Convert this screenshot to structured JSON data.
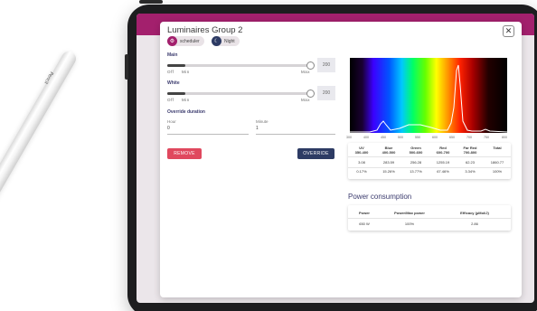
{
  "pencil": {
    "brand": "Pencil"
  },
  "modal": {
    "title": "Luminaires Group 2",
    "close_label": "✕",
    "chips": [
      {
        "label": "scheduler",
        "icon": "scheduler-icon",
        "color": "#a3206d"
      },
      {
        "label": "Night",
        "icon": "moon-icon",
        "color": "#2d3b64"
      }
    ]
  },
  "main": {
    "label": "Main",
    "off": "Off",
    "min": "Min",
    "max": "Max",
    "value": "200",
    "level": 1.0
  },
  "white": {
    "label": "White",
    "off": "Off",
    "min": "Min",
    "max": "Max",
    "value": "200",
    "level": 1.0
  },
  "override": {
    "label": "Override duration",
    "hour_label": "Hour",
    "hour_value": "0",
    "minute_label": "Minute",
    "minute_value": "1",
    "remove_label": "REMOVE",
    "override_label": "OVERRIDE"
  },
  "colors": {
    "accent": "#a3206d",
    "navy": "#2d3b64",
    "remove": "#e0485e"
  },
  "spectrum": {
    "ticks": [
      "300",
      "400",
      "450",
      "500",
      "550",
      "600",
      "650",
      "700",
      "750",
      "800"
    ]
  },
  "bands_table": {
    "headers": [
      [
        "UV",
        "350-400"
      ],
      [
        "Blue",
        "400-500"
      ],
      [
        "Green",
        "500-600"
      ],
      [
        "Red",
        "600-700"
      ],
      [
        "Far Red",
        "700-800"
      ],
      [
        "Total",
        ""
      ]
    ],
    "rows": [
      [
        "3.08",
        "283.59",
        "256.28",
        "1255.19",
        "62.23",
        "1860.77"
      ],
      [
        "0.17%",
        "15.26%",
        "13.77%",
        "67.46%",
        "3.34%",
        "100%"
      ]
    ]
  },
  "power": {
    "title": "Power consumption",
    "headers": [
      "Power",
      "Power/Max power",
      "Efficacy (µMol/J)"
    ],
    "row": [
      "650 W",
      "100%",
      "2.86"
    ]
  }
}
